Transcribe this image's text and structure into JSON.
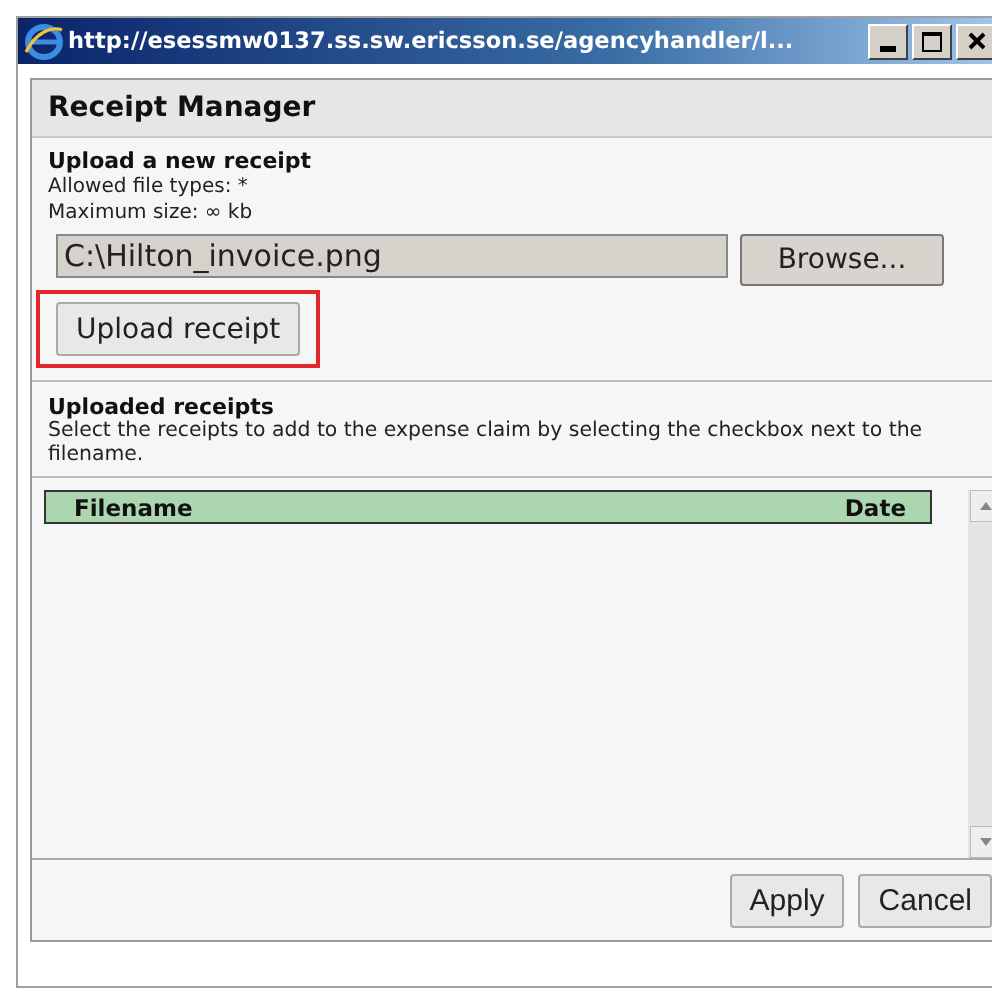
{
  "window": {
    "title": "http://esessmw0137.ss.sw.ericsson.se/agencyhandler/l..."
  },
  "dialog": {
    "title": "Receipt Manager"
  },
  "upload": {
    "heading": "Upload a new receipt",
    "allowed": "Allowed file types: *",
    "max_size": "Maximum size: ∞ kb",
    "file_value": "C:\\Hilton_invoice.png",
    "browse": "Browse...",
    "upload_button": "Upload receipt",
    "highlighted": true
  },
  "uploaded": {
    "heading": "Uploaded receipts",
    "description": "Select the receipts to add to the expense claim by selecting the checkbox next to the filename."
  },
  "table": {
    "columns": [
      "Filename",
      "Date"
    ]
  },
  "buttons": [
    "Apply",
    "Cancel"
  ]
}
